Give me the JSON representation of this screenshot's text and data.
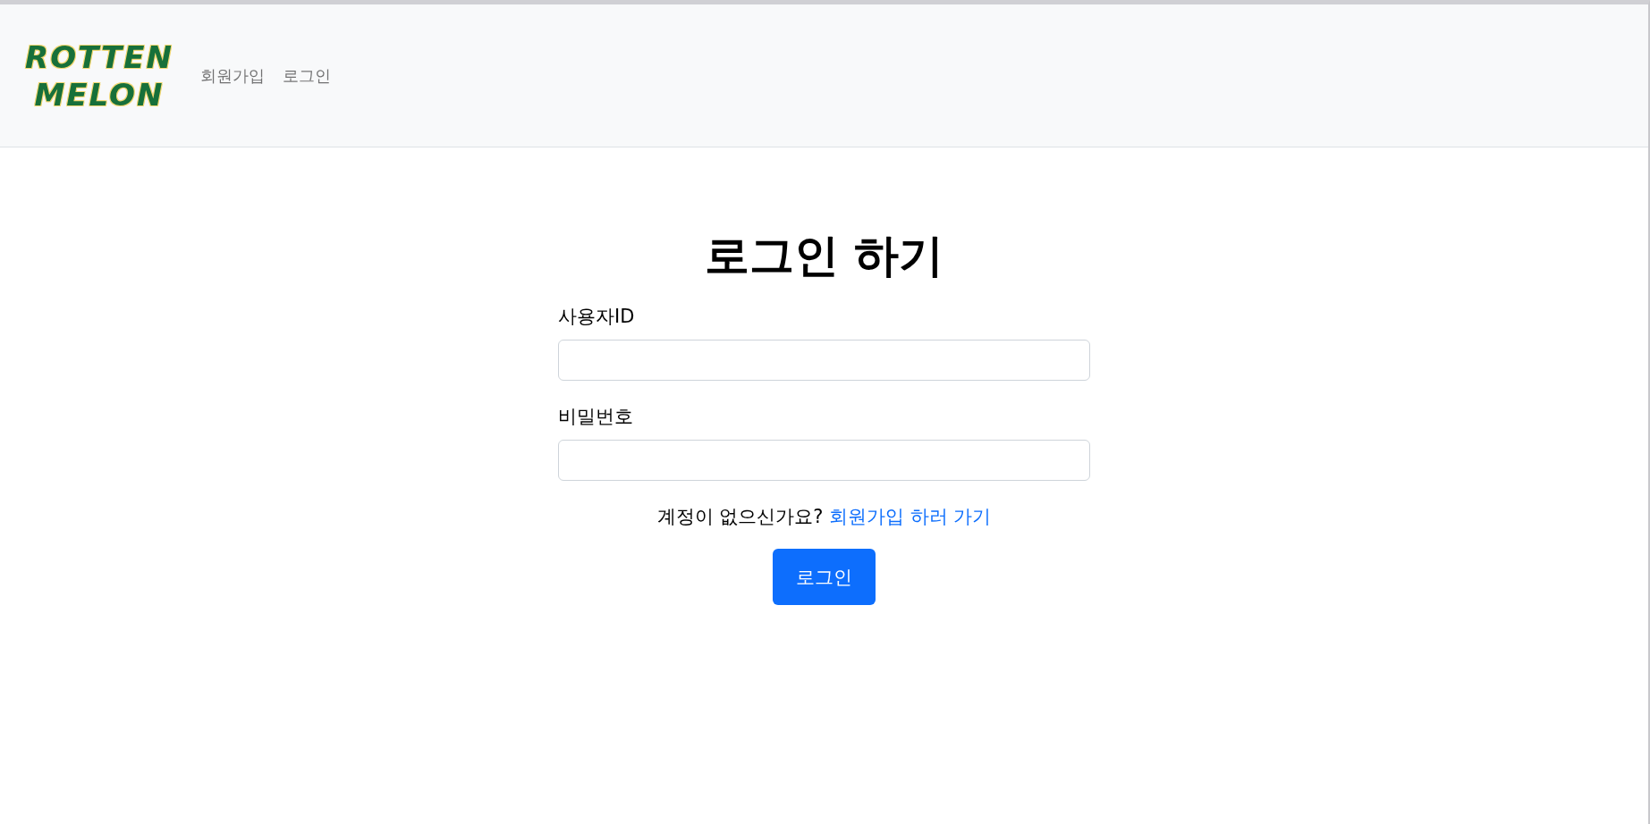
{
  "navbar": {
    "logo": {
      "lines": [
        "ROTTEN",
        "MELON"
      ]
    },
    "links": [
      {
        "label": "회원가입"
      },
      {
        "label": "로그인"
      }
    ]
  },
  "login_form": {
    "title": "로그인 하기",
    "fields": [
      {
        "label": "사용자ID"
      },
      {
        "label": "비밀번호"
      }
    ],
    "signup_prompt": {
      "text": "계정이 없으신가요?",
      "link": "회원가입 하러 가기"
    },
    "submit_button": "로그인"
  }
}
